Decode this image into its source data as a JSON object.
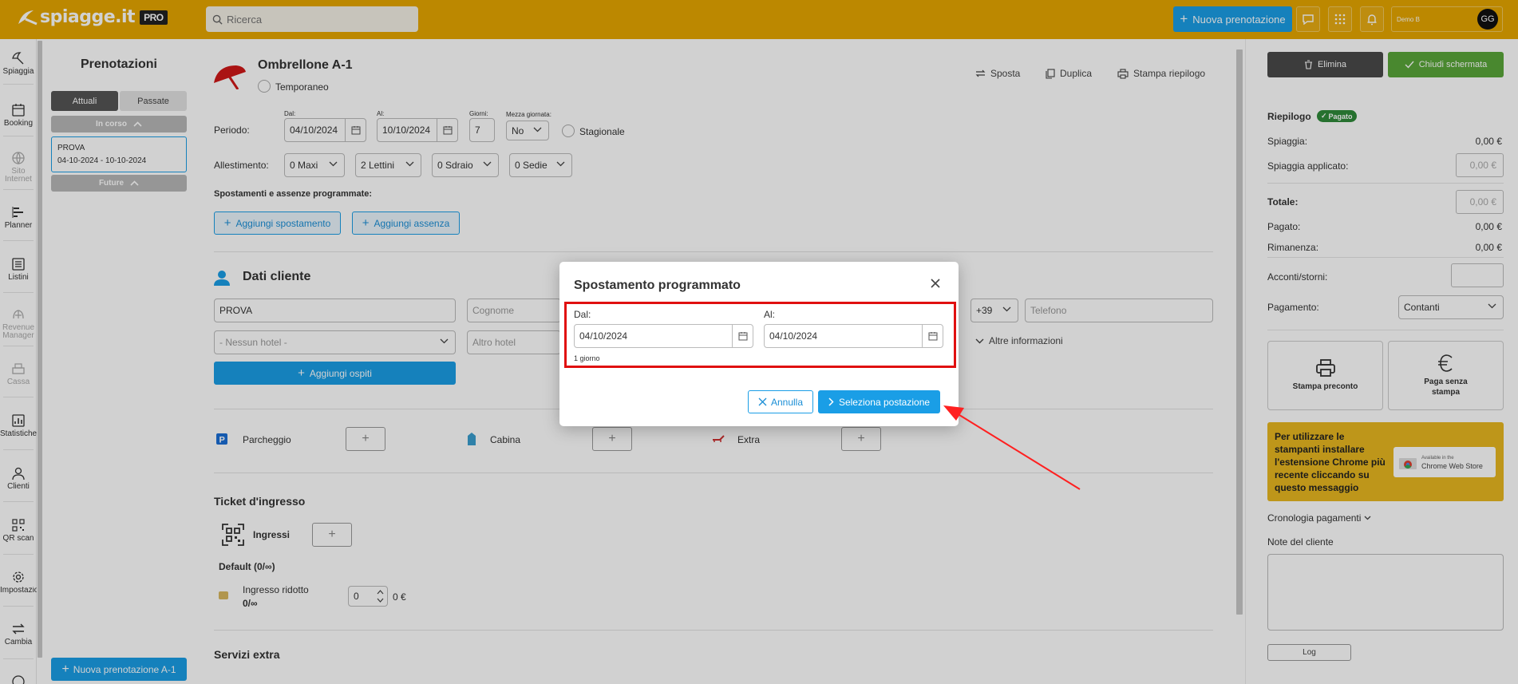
{
  "topbar": {
    "logo_text": "spiagge.it",
    "logo_badge": "PRO",
    "search_placeholder": "Ricerca",
    "new_booking_label": "Nuova prenotazione",
    "user_name": "Demo B",
    "user_initials": "GG"
  },
  "nav": {
    "items": [
      {
        "label": "Spiaggia",
        "icon": "beach-umbrella-icon"
      },
      {
        "label": "Booking",
        "icon": "calendar-icon"
      },
      {
        "label": "Sito Internet",
        "icon": "globe-icon"
      },
      {
        "label": "Planner",
        "icon": "planner-bars-icon"
      },
      {
        "label": "Listini",
        "icon": "list-icon"
      },
      {
        "label": "Revenue Manager",
        "icon": "revenue-icon"
      },
      {
        "label": "Cassa",
        "icon": "cash-register-icon"
      },
      {
        "label": "Statistiche",
        "icon": "stats-chart-icon"
      },
      {
        "label": "Clienti",
        "icon": "user-icon"
      },
      {
        "label": "QR scan",
        "icon": "qr-icon"
      },
      {
        "label": "Impostazioni",
        "icon": "gear-icon"
      },
      {
        "label": "Cambia",
        "icon": "swap-arrows-icon"
      }
    ]
  },
  "bookings": {
    "title": "Prenotazioni",
    "tab_current": "Attuali",
    "tab_past": "Passate",
    "group_current": "In corso",
    "group_future": "Future",
    "card_name": "PROVA",
    "card_dates": "04-10-2024 - 10-10-2024",
    "new_booking_label": "Nuova prenotazione A-1"
  },
  "main": {
    "umbrella_title": "Ombrellone A-1",
    "temporary_label": "Temporaneo",
    "actions": {
      "move": "Sposta",
      "duplicate": "Duplica",
      "print": "Stampa riepilogo"
    },
    "period_label": "Periodo:",
    "from_small": "Dal:",
    "from_value": "04/10/2024",
    "to_small": "Al:",
    "to_value": "10/10/2024",
    "days_small": "Giorni:",
    "days_value": "7",
    "half_day_small": "Mezza giornata:",
    "half_day_value": "No",
    "seasonal_label": "Stagionale",
    "setup_label": "Allestimento:",
    "setup": {
      "maxi": "0 Maxi",
      "lettini": "2 Lettini",
      "sdraio": "0 Sdraio",
      "sedie": "0 Sedie"
    },
    "moves_label": "Spostamenti e assenze programmate:",
    "add_move_label": "Aggiungi spostamento",
    "add_absence_label": "Aggiungi assenza",
    "client_title": "Dati cliente",
    "client_name_value": "PROVA",
    "surname_placeholder": "Cognome",
    "phone_prefix": "+39",
    "phone_placeholder": "Telefono",
    "hotel_placeholder": "- Nessun hotel -",
    "other_hotel_placeholder": "Altro hotel",
    "more_info_label": "Altre informazioni",
    "add_guests_label": "Aggiungi ospiti",
    "parking_label": "Parcheggio",
    "cabin_label": "Cabina",
    "extra_label": "Extra",
    "ticket_title": "Ticket d'ingresso",
    "entries_label": "Ingressi",
    "default_label": "Default (0/∞)",
    "reduced_label": "Ingresso ridotto",
    "reduced_count": "0/∞",
    "reduced_qty": "0",
    "reduced_price": "0 €",
    "extra_services_title": "Servizi extra"
  },
  "summary": {
    "delete_label": "Elimina",
    "close_label": "Chiudi schermata",
    "title": "Riepilogo",
    "paid_badge": "Pagato",
    "beach_label": "Spiaggia:",
    "beach_value": "0,00 €",
    "beach_applied_label": "Spiaggia applicato:",
    "beach_applied_value": "0,00 €",
    "total_label": "Totale:",
    "total_value": "0,00 €",
    "paid_label": "Pagato:",
    "paid_value": "0,00 €",
    "remaining_label": "Rimanenza:",
    "remaining_value": "0,00 €",
    "deposits_label": "Acconti/storni:",
    "payment_label": "Pagamento:",
    "payment_value": "Contanti",
    "print_preconto": "Stampa preconto",
    "pay_no_print": "Paga senza stampa",
    "printer_notice": "Per utilizzare le stampanti installare l'estensione Chrome più recente cliccando su questo messaggio",
    "chrome_store_small": "Available in the",
    "chrome_store": "Chrome Web Store",
    "history_label": "Cronologia pagamenti",
    "notes_label": "Note del cliente",
    "log_label": "Log"
  },
  "modal": {
    "title": "Spostamento programmato",
    "from_label": "Dal:",
    "from_value": "04/10/2024",
    "to_label": "Al:",
    "to_value": "04/10/2024",
    "duration": "1 giorno",
    "cancel_label": "Annulla",
    "select_label": "Seleziona postazione"
  },
  "colors": {
    "topbar": "#e6a600",
    "accent": "#1a9ee6",
    "delete": "#4a4a4a",
    "close": "#5aa63a",
    "highlight": "#e01010",
    "notice": "#e8b820"
  }
}
